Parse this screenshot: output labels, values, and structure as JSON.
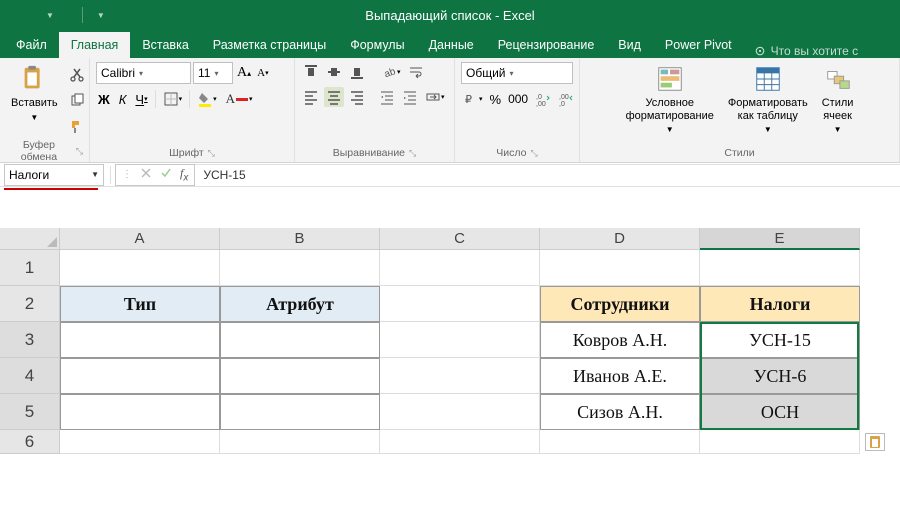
{
  "app": {
    "title": "Выпадающий список - Excel"
  },
  "tabs": {
    "file": "Файл",
    "home": "Главная",
    "insert": "Вставка",
    "page_layout": "Разметка страницы",
    "formulas": "Формулы",
    "data": "Данные",
    "review": "Рецензирование",
    "view": "Вид",
    "power_pivot": "Power Pivot",
    "tell_me": "Что вы хотите с"
  },
  "ribbon": {
    "clipboard": {
      "paste": "Вставить",
      "label": "Буфер обмена"
    },
    "font": {
      "name": "Calibri",
      "size": "11",
      "label": "Шрифт",
      "bold": "Ж",
      "italic": "К",
      "underline": "Ч"
    },
    "alignment": {
      "label": "Выравнивание"
    },
    "number": {
      "format": "Общий",
      "label": "Число"
    },
    "styles": {
      "conditional": "Условное\nформатирование",
      "format_table": "Форматировать\nкак таблицу",
      "cell_styles": "Стили\nячеек",
      "label": "Стили"
    }
  },
  "fbar": {
    "name": "Налоги",
    "formula": "УСН-15"
  },
  "grid": {
    "cols": [
      "A",
      "B",
      "C",
      "D",
      "E"
    ],
    "rows": [
      "1",
      "2",
      "3",
      "4",
      "5",
      "6"
    ],
    "a2": "Тип",
    "b2": "Атрибут",
    "d2": "Сотрудники",
    "e2": "Налоги",
    "d3": "Ковров А.Н.",
    "e3": "УСН-15",
    "d4": "Иванов А.Е.",
    "e4": "УСН-6",
    "d5": "Сизов А.Н.",
    "e5": "ОСН"
  }
}
